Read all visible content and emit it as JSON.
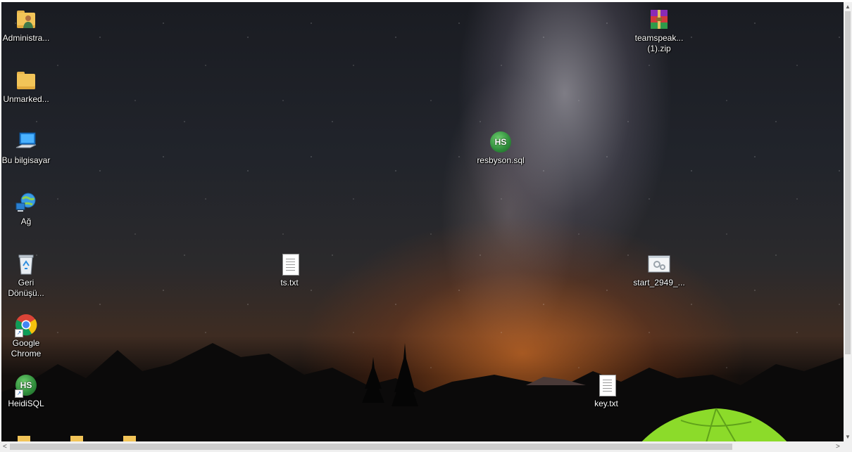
{
  "desktop": {
    "icons": {
      "administrator": "Administra...",
      "unmarked": "Unmarked...",
      "this_pc": "Bu bilgisayar",
      "network": "Ağ",
      "recycle_bin": "Geri Dönüşü...",
      "chrome": "Google Chrome",
      "heidisql": "HeidiSQL",
      "ts_txt": "ts.txt",
      "resbyson_sql": "resbyson.sql",
      "teamspeak_zip": "teamspeak... (1).zip",
      "start_2949": "start_2949_...",
      "key_txt": "key.txt"
    },
    "heidisql_badge": "HS",
    "icon_names": [
      "user-folder-icon",
      "folder-icon",
      "computer-icon",
      "network-globe-icon",
      "recycle-bin-icon",
      "chrome-icon",
      "heidisql-icon",
      "text-file-icon",
      "winrar-archive-icon",
      "batch-file-icon"
    ]
  },
  "scrollbars": {
    "up_arrow": "▲",
    "down_arrow": "▼",
    "left_arrow": "<",
    "right_arrow": ">"
  },
  "colors": {
    "folder": "#f2c458",
    "heidisql_green": "#2e8b3a",
    "tent_green": "#8cdb2a",
    "scrollbar_track": "#f0f0f0",
    "scrollbar_thumb": "#cdcdcd"
  }
}
